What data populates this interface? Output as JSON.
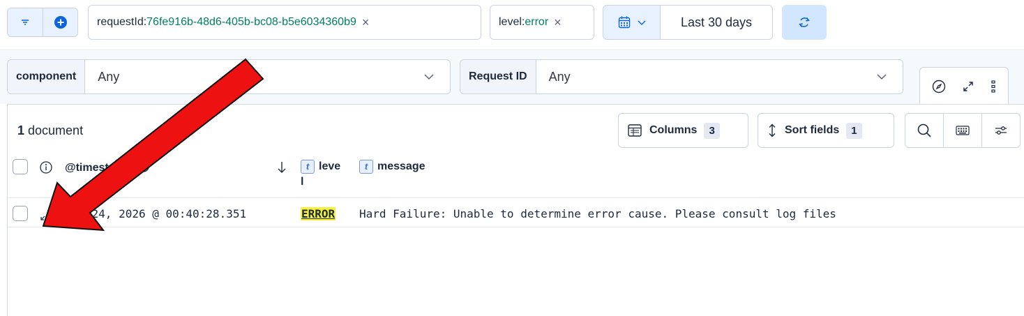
{
  "filters": {
    "request": {
      "key": "requestId: ",
      "value": "76fe916b-48d6-405b-bc08-b5e6034360b9",
      "remove": "×"
    },
    "level": {
      "key": "level: ",
      "value": "error",
      "remove": "×"
    },
    "date_range": "Last 30 days"
  },
  "controls": {
    "component": {
      "label": "component",
      "value": "Any"
    },
    "request_id": {
      "label": "Request ID",
      "value": "Any"
    }
  },
  "results": {
    "count": "1",
    "count_suffix": " document",
    "columns_label": "Columns",
    "columns_count": "3",
    "sort_label": "Sort fields",
    "sort_count": "1"
  },
  "table": {
    "headers": {
      "timestamp": "@timestamp",
      "level": "leve",
      "level_wrap": "l",
      "message": "message"
    },
    "rows": [
      {
        "timestamp": "Mar 24, 2026 @ 00:40:28.351",
        "level": "ERROR",
        "message": "Hard Failure: Unable to determine error cause. Please consult log files"
      }
    ]
  },
  "colors": {
    "accent": "#0b64dd",
    "filter_value": "#00805c",
    "highlight": "#f7f13a",
    "annotation_arrow": "#ee1111"
  },
  "icons": [
    "filter-icon",
    "add-filter-icon",
    "calendar-icon",
    "refresh-icon",
    "chevron-down-icon",
    "compass-icon",
    "expand-icon",
    "more-icon",
    "columns-icon",
    "sort-icon",
    "search-icon",
    "keyboard-icon",
    "settings-sliders-icon",
    "info-icon",
    "clock-icon",
    "sort-arrow-icon"
  ]
}
